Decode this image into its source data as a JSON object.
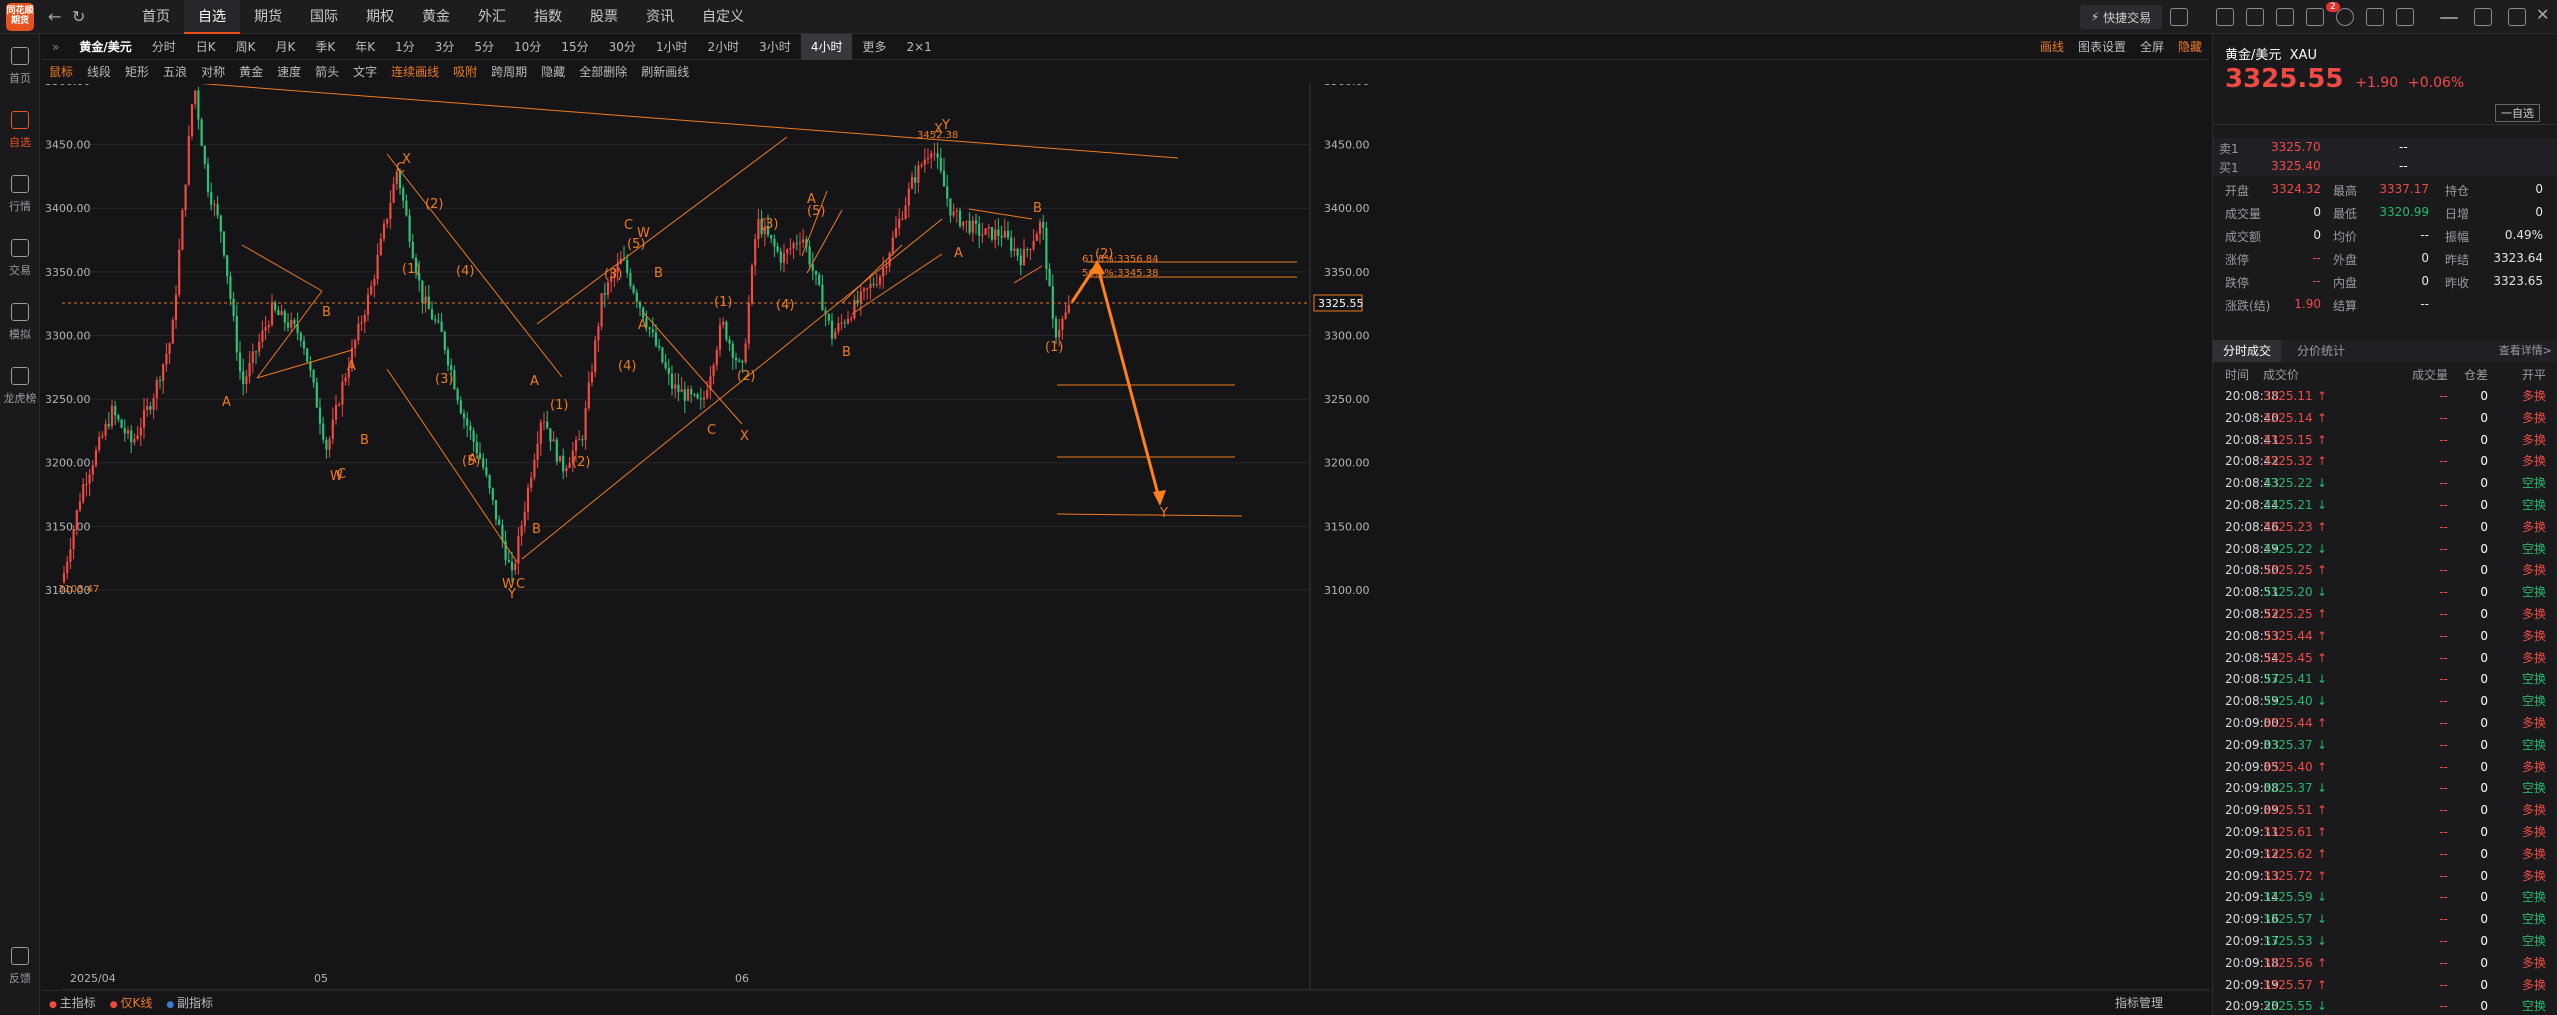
{
  "app": {
    "logo_text": "同花顺",
    "logo_sub": "期货"
  },
  "nav": {
    "back_icon": "back-icon",
    "refresh_icon": "refresh-icon",
    "menu": [
      "首页",
      "自选",
      "期货",
      "国际",
      "期权",
      "黄金",
      "外汇",
      "指数",
      "股票",
      "资讯",
      "自定义"
    ],
    "active": "自选"
  },
  "topright": {
    "quick_trade": "快捷交易",
    "badge": "2"
  },
  "leftnav": [
    {
      "label": "首页"
    },
    {
      "label": "自选"
    },
    {
      "label": "行情"
    },
    {
      "label": "交易"
    },
    {
      "label": "模拟"
    },
    {
      "label": "龙虎榜"
    },
    {
      "label": "反馈"
    }
  ],
  "toolbar": {
    "symbol": "黄金/美元",
    "periods": [
      "分时",
      "日K",
      "周K",
      "月K",
      "季K",
      "年K",
      "1分",
      "3分",
      "5分",
      "10分",
      "15分",
      "30分",
      "1小时",
      "2小时",
      "3小时",
      "4小时",
      "更多",
      "2×1"
    ],
    "active_period": "4小时",
    "right": [
      "画线",
      "图表设置",
      "全屏",
      "隐藏"
    ]
  },
  "drawtools": [
    "鼠标",
    "线段",
    "矩形",
    "五浪",
    "对称",
    "黄金",
    "速度",
    "箭头",
    "文字",
    "连续画线",
    "吸附",
    "跨周期",
    "隐藏",
    "全部删除",
    "刷新画线"
  ],
  "chart": {
    "mode_label": "仅K线",
    "y_axis": [
      3500,
      3450,
      3400,
      3350,
      3300,
      3250,
      3200,
      3150,
      3100
    ],
    "y_labels": [
      "3500.00",
      "3450.00",
      "3400.00",
      "3350.00",
      "3300.00",
      "3250.00",
      "3200.00",
      "3150.00",
      "3100.00"
    ],
    "x_labels": [
      "2025/04",
      "05",
      "06"
    ],
    "last_price_label": "3325.55",
    "last_price": 3325.55,
    "annotations": {
      "high": "3500.10",
      "low": "3103.47",
      "peak2": "3452.38",
      "fib1": "61.8%:3356.84",
      "fib2": "50.0%:3345.38"
    },
    "wave_labels": [
      "A",
      "B",
      "C",
      "W",
      "X",
      "Y",
      "(1)",
      "(2)",
      "(3)",
      "(4)",
      "(5)"
    ]
  },
  "chart_data": {
    "type": "candlestick",
    "title": "",
    "ylim": [
      3090,
      3520
    ],
    "overall": {
      "start": 3103.47,
      "high": 3500.1,
      "low": 3103.47,
      "last": 3325.55
    }
  },
  "bottombar": {
    "items": [
      "主指标",
      "仅K线",
      "副指标"
    ],
    "right": "指标管理"
  },
  "quote": {
    "title": "黄金/美元",
    "code": "XAU",
    "price": "3325.55",
    "change": "+1.90",
    "change_pct": "+0.06%",
    "watch_btn": "一自选",
    "sell_label": "卖1",
    "sell_price": "3325.70",
    "sell_vol": "--",
    "buy_label": "买1",
    "buy_price": "3325.40",
    "buy_vol": "--",
    "stats": [
      [
        "开盘",
        "3324.32",
        "最高",
        "3337.17",
        "持仓",
        "0"
      ],
      [
        "成交量",
        "0",
        "最低",
        "3320.99",
        "日增",
        "0"
      ],
      [
        "成交额",
        "0",
        "均价",
        "--",
        "振幅",
        "0.49%"
      ],
      [
        "涨停",
        "--",
        "外盘",
        "0",
        "昨结",
        "3323.64"
      ],
      [
        "跌停",
        "--",
        "内盘",
        "0",
        "昨收",
        "3323.65"
      ],
      [
        "涨跌(结)",
        "1.90",
        "结算",
        "--",
        "",
        ""
      ]
    ]
  },
  "tabs": {
    "items": [
      "分时成交",
      "分价统计"
    ],
    "more": "查看详情>"
  },
  "trades": {
    "headers": [
      "时间",
      "成交价",
      "成交量",
      "仓差",
      "开平"
    ],
    "rows": [
      [
        "20:08:38",
        "3325.11",
        "up",
        "--",
        "0",
        "多换"
      ],
      [
        "20:08:40",
        "3325.14",
        "up",
        "--",
        "0",
        "多换"
      ],
      [
        "20:08:41",
        "3325.15",
        "up",
        "--",
        "0",
        "多换"
      ],
      [
        "20:08:42",
        "3325.32",
        "up",
        "--",
        "0",
        "多换"
      ],
      [
        "20:08:43",
        "3325.22",
        "down",
        "--",
        "0",
        "空换"
      ],
      [
        "20:08:44",
        "3325.21",
        "down",
        "--",
        "0",
        "空换"
      ],
      [
        "20:08:46",
        "3325.23",
        "up",
        "--",
        "0",
        "多换"
      ],
      [
        "20:08:49",
        "3325.22",
        "down",
        "--",
        "0",
        "空换"
      ],
      [
        "20:08:50",
        "3325.25",
        "up",
        "--",
        "0",
        "多换"
      ],
      [
        "20:08:51",
        "3325.20",
        "down",
        "--",
        "0",
        "空换"
      ],
      [
        "20:08:52",
        "3325.25",
        "up",
        "--",
        "0",
        "多换"
      ],
      [
        "20:08:53",
        "3325.44",
        "up",
        "--",
        "0",
        "多换"
      ],
      [
        "20:08:54",
        "3325.45",
        "up",
        "--",
        "0",
        "多换"
      ],
      [
        "20:08:57",
        "3325.41",
        "down",
        "--",
        "0",
        "空换"
      ],
      [
        "20:08:59",
        "3325.40",
        "down",
        "--",
        "0",
        "空换"
      ],
      [
        "20:09:00",
        "3325.44",
        "up",
        "--",
        "0",
        "多换"
      ],
      [
        "20:09:03",
        "3325.37",
        "down",
        "--",
        "0",
        "空换"
      ],
      [
        "20:09:05",
        "3325.40",
        "up",
        "--",
        "0",
        "多换"
      ],
      [
        "20:09:08",
        "3325.37",
        "down",
        "--",
        "0",
        "空换"
      ],
      [
        "20:09:09",
        "3325.51",
        "up",
        "--",
        "0",
        "多换"
      ],
      [
        "20:09:11",
        "3325.61",
        "up",
        "--",
        "0",
        "多换"
      ],
      [
        "20:09:12",
        "3325.62",
        "up",
        "--",
        "0",
        "多换"
      ],
      [
        "20:09:13",
        "3325.72",
        "up",
        "--",
        "0",
        "多换"
      ],
      [
        "20:09:14",
        "3325.59",
        "down",
        "--",
        "0",
        "空换"
      ],
      [
        "20:09:16",
        "3325.57",
        "down",
        "--",
        "0",
        "空换"
      ],
      [
        "20:09:17",
        "3325.53",
        "down",
        "--",
        "0",
        "空换"
      ],
      [
        "20:09:18",
        "3325.56",
        "up",
        "--",
        "0",
        "多换"
      ],
      [
        "20:09:19",
        "3325.57",
        "up",
        "--",
        "0",
        "多换"
      ],
      [
        "20:09:20",
        "3325.55",
        "down",
        "--",
        "0",
        "空换"
      ]
    ]
  },
  "colors": {
    "up": "#f04a43",
    "down": "#26b86d",
    "accent": "#e8521f",
    "draw": "#f07b1f"
  }
}
